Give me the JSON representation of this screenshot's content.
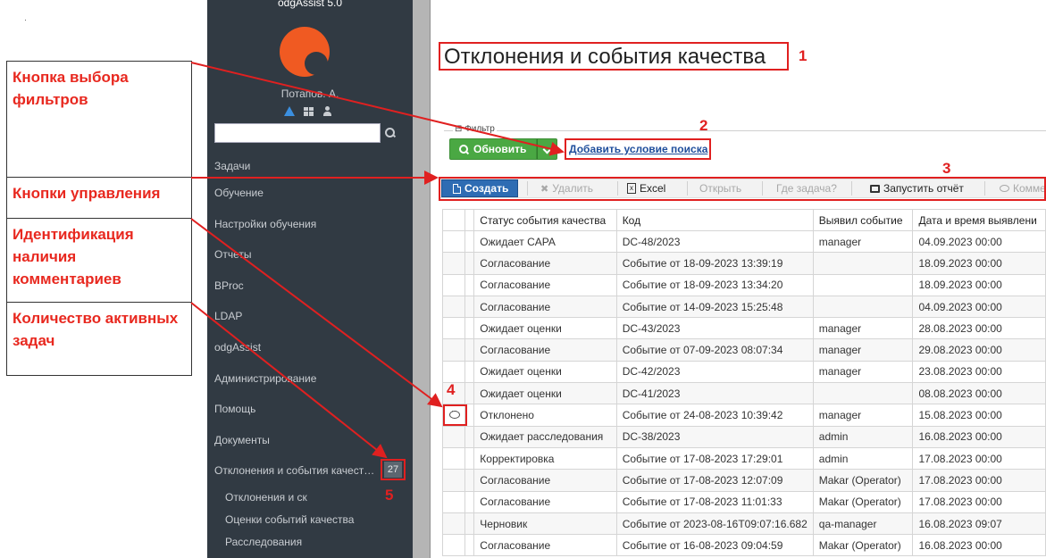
{
  "app": {
    "title": "odgAssist 5.0"
  },
  "user": {
    "name": "Потапов. А."
  },
  "sidebar": {
    "items": [
      {
        "label": "Задачи"
      },
      {
        "label": "Обучение"
      },
      {
        "label": "Настройки обучения"
      },
      {
        "label": "Отчеты"
      },
      {
        "label": "BProc"
      },
      {
        "label": "LDAP"
      },
      {
        "label": "odgAssist"
      },
      {
        "label": "Администрирование"
      },
      {
        "label": "Помощь"
      },
      {
        "label": "Документы"
      },
      {
        "label": "Отклонения и события качест…",
        "badge": "27"
      }
    ],
    "subitems": [
      {
        "label": "Отклонения и ск"
      },
      {
        "label": "Оценки событий качества"
      },
      {
        "label": "Расследования"
      }
    ]
  },
  "page": {
    "title": "Отклонения и события качества"
  },
  "filter": {
    "legend": "⊟ Фильтр",
    "refresh_label": "Обновить",
    "add_condition": "Добавить условие поиска"
  },
  "toolbar": {
    "create": "Создать",
    "delete": "Удалить",
    "excel": "Excel",
    "open": "Открыть",
    "where_task": "Где задача?",
    "run_report": "Запустить отчёт",
    "comment": "Комме"
  },
  "table": {
    "columns": [
      "Статус события качества",
      "Код",
      "Выявил событие",
      "Дата и время выявлени"
    ],
    "rows": [
      {
        "status": "Ожидает CAPA",
        "code": "DC-48/2023",
        "found_by": "manager",
        "date": "04.09.2023 00:00",
        "comment": false
      },
      {
        "status": "Согласование",
        "code": "Событие от 18-09-2023 13:39:19",
        "found_by": "",
        "date": "18.09.2023 00:00",
        "comment": false
      },
      {
        "status": "Согласование",
        "code": "Событие от 18-09-2023 13:34:20",
        "found_by": "",
        "date": "18.09.2023 00:00",
        "comment": false
      },
      {
        "status": "Согласование",
        "code": "Событие от 14-09-2023 15:25:48",
        "found_by": "",
        "date": "04.09.2023 00:00",
        "comment": false
      },
      {
        "status": "Ожидает оценки",
        "code": "DC-43/2023",
        "found_by": "manager",
        "date": "28.08.2023 00:00",
        "comment": false
      },
      {
        "status": "Согласование",
        "code": "Событие от 07-09-2023 08:07:34",
        "found_by": "manager",
        "date": "29.08.2023 00:00",
        "comment": false
      },
      {
        "status": "Ожидает оценки",
        "code": "DC-42/2023",
        "found_by": "manager",
        "date": "23.08.2023 00:00",
        "comment": false
      },
      {
        "status": "Ожидает оценки",
        "code": "DC-41/2023",
        "found_by": "",
        "date": "08.08.2023 00:00",
        "comment": false
      },
      {
        "status": "Отклонено",
        "code": "Событие от 24-08-2023 10:39:42",
        "found_by": "manager",
        "date": "15.08.2023 00:00",
        "comment": true
      },
      {
        "status": "Ожидает расследования",
        "code": "DC-38/2023",
        "found_by": "admin",
        "date": "16.08.2023 00:00",
        "comment": false
      },
      {
        "status": "Корректировка",
        "code": "Событие от 17-08-2023 17:29:01",
        "found_by": "admin",
        "date": "17.08.2023 00:00",
        "comment": false
      },
      {
        "status": "Согласование",
        "code": "Событие от 17-08-2023 12:07:09",
        "found_by": "Makar (Operator)",
        "date": "17.08.2023 00:00",
        "comment": false
      },
      {
        "status": "Согласование",
        "code": "Событие от 17-08-2023 11:01:33",
        "found_by": "Makar (Operator)",
        "date": "17.08.2023 00:00",
        "comment": false
      },
      {
        "status": "Черновик",
        "code": "Событие от 2023-08-16T09:07:16.682",
        "found_by": "qa-manager",
        "date": "16.08.2023 09:07",
        "comment": false
      },
      {
        "status": "Согласование",
        "code": "Событие от 16-08-2023 09:04:59",
        "found_by": "Makar (Operator)",
        "date": "16.08.2023 00:00",
        "comment": false
      }
    ]
  },
  "annotations": {
    "labels": [
      "Кнопка выбора фильтров",
      "Кнопки управления",
      "Идентификация наличия комментариев",
      "Количество активных задач"
    ],
    "numbers": [
      "1",
      "2",
      "3",
      "4",
      "5"
    ],
    "color": "#e02020"
  }
}
